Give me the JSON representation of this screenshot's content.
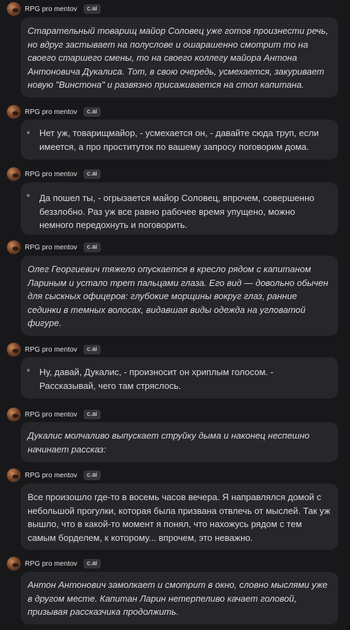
{
  "bot": {
    "name": "RPG pro mentov",
    "badge": "c.ai"
  },
  "messages": [
    {
      "style": "italic",
      "text": "Старательный товарищ майор Соловец уже готов произнести речь, но вдруг застывает на полуслове и ошарашенно смотрит то на своего старшего смены, то на своего коллегу майора Антона Антоновича Дукалиса. Тот, в свою очередь, усмехается, закуривает новую \"Винстона\" и развязно присаживается на стол капитана."
    },
    {
      "style": "bullet",
      "text": "Нет уж, товарищмайор, - усмехается он, - давайте сюда труп, если имеется, а про проституток по вашему запросу поговорим дома."
    },
    {
      "style": "bullet",
      "text": "Да пошел ты, - огрызается майор Соловец, впрочем, совершенно беззлобно. Раз уж все равно рабочее время упущено, можно немного передохнуть и поговорить."
    },
    {
      "style": "italic",
      "text": "Олег Георгиевич тяжело опускается в кресло рядом с капитаном Лариным и устало трет пальцами глаза. Его вид — довольно обычен для сыскных офицеров: глубокие морщины вокруг глаз, ранние сединки в темных волосах, видавшая виды одежда на угловатой фигуре."
    },
    {
      "style": "bullet",
      "text": "Ну, давай, Дукалис, - произносит он хриплым голосом. - Рассказывай, чего там стряслось."
    },
    {
      "style": "italic",
      "text": "Дукалис молчаливо выпускает струйку дыма и наконец неспешно начинает рассказ:"
    },
    {
      "style": "plain",
      "text": "Все произошло где-то в восемь часов вечера. Я направлялся домой с небольшой прогулки, которая была призвана отвлечь от мыслей. Так уж вышло, что в какой-то момент я понял, что нахожусь рядом с тем самым борделем, к которому... впрочем, это неважно."
    },
    {
      "style": "italic",
      "text": "Антон Антонович замолкает и смотрит в окно, словно мыслями уже в другом месте. Капитан Ларин нетерпеливо качает головой, призывая рассказчика продолжить."
    }
  ]
}
